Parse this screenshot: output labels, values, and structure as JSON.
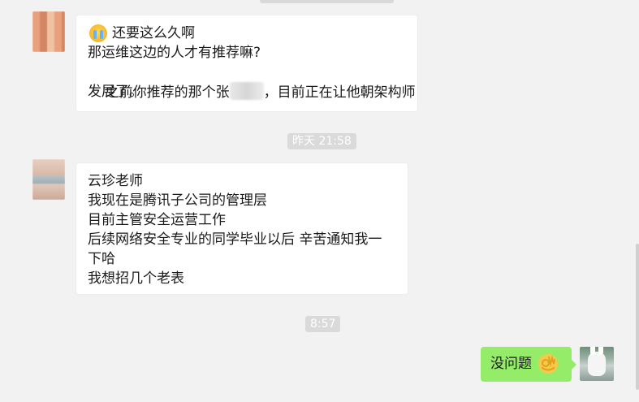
{
  "messages": [
    {
      "side": "left",
      "lines": [
        "还要这么久啊",
        "那运维这边的人才有推荐嘛?",
        "之前你推荐的那个张",
        "，目前正在让他朝架构师",
        "发展了。"
      ]
    },
    {
      "side": "left",
      "lines": [
        "云珍老师",
        "我现在是腾讯子公司的管理层",
        "目前主管安全运营工作",
        "后续网络安全专业的同学毕业以后 辛苦通知我一",
        "下哈",
        "我想招几个老表"
      ]
    },
    {
      "side": "right",
      "lines": [
        "没问题"
      ]
    }
  ],
  "timestamps": [
    "昨天 21:58",
    "8:57"
  ],
  "icons": {
    "cry": "crying-face-emoji",
    "ok": "ok-hand-emoji",
    "avatar_user": "bunny-avatar"
  },
  "colors": {
    "background": "#f2f2f2",
    "bubble_left": "#ffffff",
    "bubble_right": "#95ec69",
    "time_pill": "#dadada"
  }
}
